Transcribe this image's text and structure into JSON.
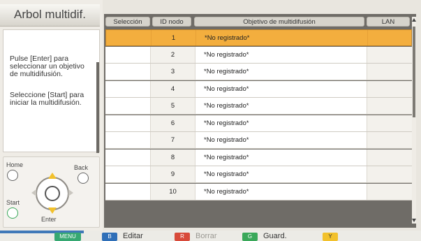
{
  "panel": {
    "title": "Arbol multidif.",
    "help_enter": "Pulse [Enter] para seleccionar un objetivo de multidifusión.",
    "help_start": "Seleccione [Start] para iniciar la multidifusión."
  },
  "remote": {
    "home": "Home",
    "back": "Back",
    "start": "Start",
    "enter": "Enter"
  },
  "table": {
    "columns": [
      "Selección",
      "ID nodo",
      "Objetivo de multidifusión",
      "LAN"
    ],
    "rows": [
      {
        "id": "1",
        "target": "*No registrado*",
        "selected": true
      },
      {
        "id": "2",
        "target": "*No registrado*"
      },
      {
        "id": "3",
        "target": "*No registrado*"
      },
      {
        "id": "4",
        "target": "*No registrado*"
      },
      {
        "id": "5",
        "target": "*No registrado*"
      },
      {
        "id": "6",
        "target": "*No registrado*"
      },
      {
        "id": "7",
        "target": "*No registrado*"
      },
      {
        "id": "8",
        "target": "*No registrado*"
      },
      {
        "id": "9",
        "target": "*No registrado*"
      },
      {
        "id": "10",
        "target": "*No registrado*"
      }
    ]
  },
  "bottom_bar": {
    "menu_badge": "MENU",
    "b_badge": "B",
    "b_label": "Editar",
    "r_badge": "R",
    "r_label": "Borrar",
    "g_badge": "G",
    "g_label": "Guard.",
    "y_badge": "Y",
    "colors": {
      "menu": "#36a872",
      "b": "#2f6fb8",
      "r": "#d84a3a",
      "g": "#3aa85a",
      "y": "#f2c12c",
      "selected_row": "#f3ae3e"
    }
  }
}
